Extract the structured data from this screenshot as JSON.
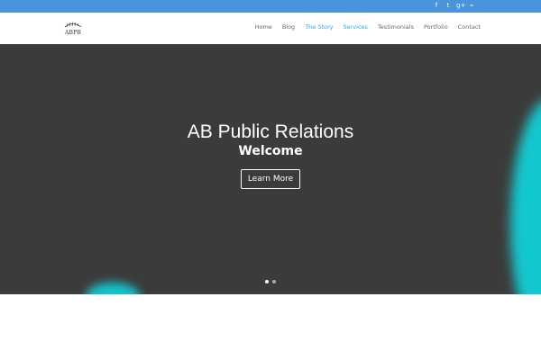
{
  "topbar": {
    "color": "#4a94dc",
    "social_icons": [
      {
        "name": "facebook-icon",
        "glyph": "f"
      },
      {
        "name": "twitter-icon",
        "glyph": "t"
      },
      {
        "name": "google-plus-icon",
        "glyph": "g+"
      },
      {
        "name": "rss-icon",
        "glyph": "⌁"
      }
    ]
  },
  "header": {
    "logo_text": "ABPR",
    "nav": [
      {
        "label": "Home",
        "active": false
      },
      {
        "label": "Blog",
        "active": false
      },
      {
        "label": "The Story",
        "active": true
      },
      {
        "label": "Services",
        "active": true
      },
      {
        "label": "Testimonials",
        "active": false
      },
      {
        "label": "Portfolio",
        "active": false
      },
      {
        "label": "Contact",
        "active": false
      }
    ],
    "accent": "#2ea3f2"
  },
  "hero": {
    "title": "AB Public Relations",
    "subtitle": "Welcome",
    "button_label": "Learn More",
    "background": "#3b3b3b",
    "slides_total": 2,
    "current_slide": 1
  }
}
